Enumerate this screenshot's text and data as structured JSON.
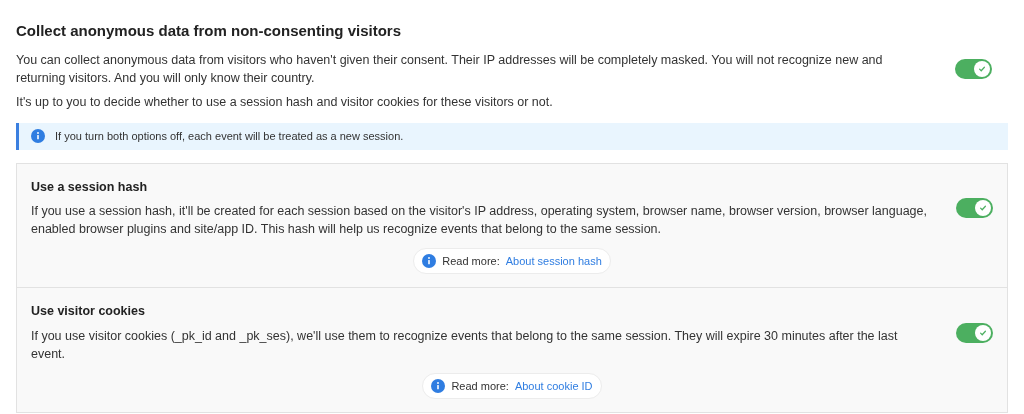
{
  "title": "Collect anonymous data from non-consenting visitors",
  "description": [
    "You can collect anonymous data from visitors who haven't given their consent. Their IP addresses will be completely masked. You will not recognize new and returning visitors. And you will only know their country.",
    "It's up to you to decide whether to use a session hash and visitor cookies for these visitors or not."
  ],
  "main_toggle": {
    "on": true
  },
  "info_notice": "If you turn both options off, each event will be treated as a new session.",
  "options": [
    {
      "title": "Use a session hash",
      "description": "If you use a session hash, it'll be created for each session based on the visitor's IP address, operating system, browser name, browser version, browser language, enabled browser plugins and site/app ID. This hash will help us recognize events that belong to the same session.",
      "on": true,
      "read_more_label": "Read more:",
      "read_more_link": "About session hash"
    },
    {
      "title": "Use visitor cookies",
      "description": "If you use visitor cookies (_pk_id and _pk_ses), we'll use them to recognize events that belong to the same session. They will expire 30 minutes after the last event.",
      "on": true,
      "read_more_label": "Read more:",
      "read_more_link": "About cookie ID"
    }
  ]
}
